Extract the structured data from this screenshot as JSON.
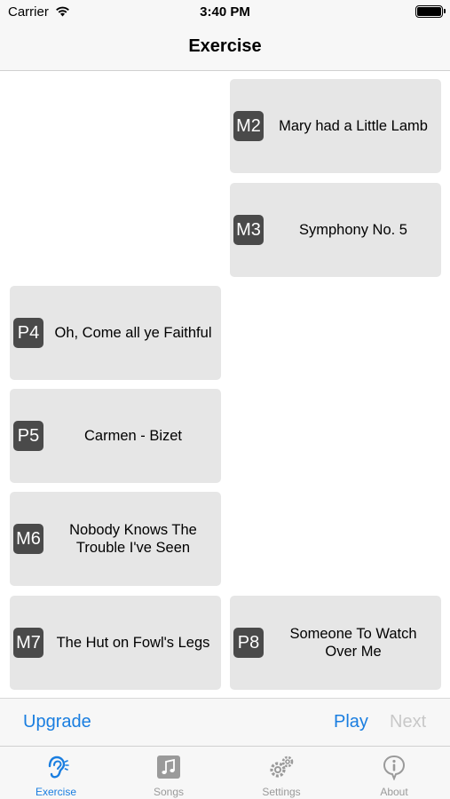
{
  "status_bar": {
    "carrier": "Carrier",
    "time": "3:40 PM"
  },
  "nav": {
    "title": "Exercise"
  },
  "cards": [
    {
      "code": "M2",
      "title": "Mary had a Little Lamb"
    },
    {
      "code": "M3",
      "title": "Symphony No. 5"
    },
    {
      "code": "P4",
      "title": "Oh, Come all ye Faithful"
    },
    {
      "code": "P5",
      "title": "Carmen - Bizet"
    },
    {
      "code": "M6",
      "title": "Nobody Knows The\nTrouble I've Seen"
    },
    {
      "code": "M7",
      "title": "The Hut on Fowl's Legs"
    },
    {
      "code": "P8",
      "title": "Someone To Watch\nOver Me"
    }
  ],
  "toolbar": {
    "upgrade_label": "Upgrade",
    "play_label": "Play",
    "next_label": "Next"
  },
  "tabs": [
    {
      "label": "Exercise",
      "icon": "ear-icon",
      "active": true
    },
    {
      "label": "Songs",
      "icon": "music-note-icon",
      "active": false
    },
    {
      "label": "Settings",
      "icon": "gears-icon",
      "active": false
    },
    {
      "label": "About",
      "icon": "info-icon",
      "active": false
    }
  ],
  "colors": {
    "accent": "#1a7ee0",
    "disabled": "#c8c8c8",
    "card_bg": "#e6e6e6",
    "badge_bg": "#4a4a4a",
    "bar_bg": "#f7f7f7"
  }
}
